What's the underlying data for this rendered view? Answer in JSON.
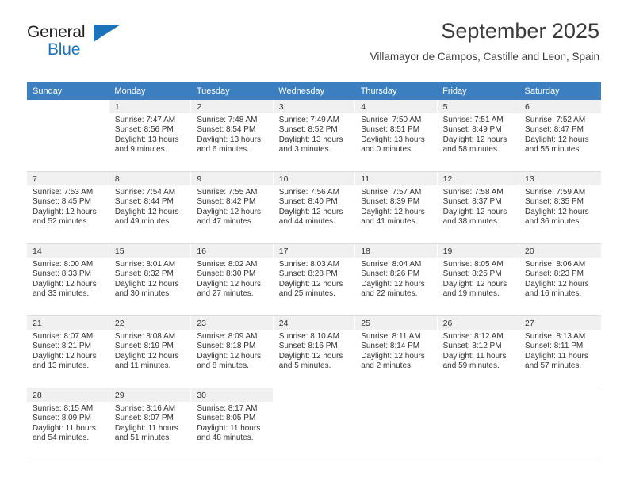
{
  "brand": {
    "name_top": "General",
    "name_bottom": "Blue",
    "accent_color": "#1b74bb"
  },
  "header": {
    "title": "September 2025",
    "subtitle": "Villamayor de Campos, Castille and Leon, Spain"
  },
  "calendar": {
    "header_background": "#3c7fc1",
    "daynum_background": "#f0f0f0",
    "weekday_headers": [
      "Sunday",
      "Monday",
      "Tuesday",
      "Wednesday",
      "Thursday",
      "Friday",
      "Saturday"
    ],
    "weeks": [
      [
        {
          "day": "",
          "lines": []
        },
        {
          "day": "1",
          "lines": [
            "Sunrise: 7:47 AM",
            "Sunset: 8:56 PM",
            "Daylight: 13 hours",
            "and 9 minutes."
          ]
        },
        {
          "day": "2",
          "lines": [
            "Sunrise: 7:48 AM",
            "Sunset: 8:54 PM",
            "Daylight: 13 hours",
            "and 6 minutes."
          ]
        },
        {
          "day": "3",
          "lines": [
            "Sunrise: 7:49 AM",
            "Sunset: 8:52 PM",
            "Daylight: 13 hours",
            "and 3 minutes."
          ]
        },
        {
          "day": "4",
          "lines": [
            "Sunrise: 7:50 AM",
            "Sunset: 8:51 PM",
            "Daylight: 13 hours",
            "and 0 minutes."
          ]
        },
        {
          "day": "5",
          "lines": [
            "Sunrise: 7:51 AM",
            "Sunset: 8:49 PM",
            "Daylight: 12 hours",
            "and 58 minutes."
          ]
        },
        {
          "day": "6",
          "lines": [
            "Sunrise: 7:52 AM",
            "Sunset: 8:47 PM",
            "Daylight: 12 hours",
            "and 55 minutes."
          ]
        }
      ],
      [
        {
          "day": "7",
          "lines": [
            "Sunrise: 7:53 AM",
            "Sunset: 8:45 PM",
            "Daylight: 12 hours",
            "and 52 minutes."
          ]
        },
        {
          "day": "8",
          "lines": [
            "Sunrise: 7:54 AM",
            "Sunset: 8:44 PM",
            "Daylight: 12 hours",
            "and 49 minutes."
          ]
        },
        {
          "day": "9",
          "lines": [
            "Sunrise: 7:55 AM",
            "Sunset: 8:42 PM",
            "Daylight: 12 hours",
            "and 47 minutes."
          ]
        },
        {
          "day": "10",
          "lines": [
            "Sunrise: 7:56 AM",
            "Sunset: 8:40 PM",
            "Daylight: 12 hours",
            "and 44 minutes."
          ]
        },
        {
          "day": "11",
          "lines": [
            "Sunrise: 7:57 AM",
            "Sunset: 8:39 PM",
            "Daylight: 12 hours",
            "and 41 minutes."
          ]
        },
        {
          "day": "12",
          "lines": [
            "Sunrise: 7:58 AM",
            "Sunset: 8:37 PM",
            "Daylight: 12 hours",
            "and 38 minutes."
          ]
        },
        {
          "day": "13",
          "lines": [
            "Sunrise: 7:59 AM",
            "Sunset: 8:35 PM",
            "Daylight: 12 hours",
            "and 36 minutes."
          ]
        }
      ],
      [
        {
          "day": "14",
          "lines": [
            "Sunrise: 8:00 AM",
            "Sunset: 8:33 PM",
            "Daylight: 12 hours",
            "and 33 minutes."
          ]
        },
        {
          "day": "15",
          "lines": [
            "Sunrise: 8:01 AM",
            "Sunset: 8:32 PM",
            "Daylight: 12 hours",
            "and 30 minutes."
          ]
        },
        {
          "day": "16",
          "lines": [
            "Sunrise: 8:02 AM",
            "Sunset: 8:30 PM",
            "Daylight: 12 hours",
            "and 27 minutes."
          ]
        },
        {
          "day": "17",
          "lines": [
            "Sunrise: 8:03 AM",
            "Sunset: 8:28 PM",
            "Daylight: 12 hours",
            "and 25 minutes."
          ]
        },
        {
          "day": "18",
          "lines": [
            "Sunrise: 8:04 AM",
            "Sunset: 8:26 PM",
            "Daylight: 12 hours",
            "and 22 minutes."
          ]
        },
        {
          "day": "19",
          "lines": [
            "Sunrise: 8:05 AM",
            "Sunset: 8:25 PM",
            "Daylight: 12 hours",
            "and 19 minutes."
          ]
        },
        {
          "day": "20",
          "lines": [
            "Sunrise: 8:06 AM",
            "Sunset: 8:23 PM",
            "Daylight: 12 hours",
            "and 16 minutes."
          ]
        }
      ],
      [
        {
          "day": "21",
          "lines": [
            "Sunrise: 8:07 AM",
            "Sunset: 8:21 PM",
            "Daylight: 12 hours",
            "and 13 minutes."
          ]
        },
        {
          "day": "22",
          "lines": [
            "Sunrise: 8:08 AM",
            "Sunset: 8:19 PM",
            "Daylight: 12 hours",
            "and 11 minutes."
          ]
        },
        {
          "day": "23",
          "lines": [
            "Sunrise: 8:09 AM",
            "Sunset: 8:18 PM",
            "Daylight: 12 hours",
            "and 8 minutes."
          ]
        },
        {
          "day": "24",
          "lines": [
            "Sunrise: 8:10 AM",
            "Sunset: 8:16 PM",
            "Daylight: 12 hours",
            "and 5 minutes."
          ]
        },
        {
          "day": "25",
          "lines": [
            "Sunrise: 8:11 AM",
            "Sunset: 8:14 PM",
            "Daylight: 12 hours",
            "and 2 minutes."
          ]
        },
        {
          "day": "26",
          "lines": [
            "Sunrise: 8:12 AM",
            "Sunset: 8:12 PM",
            "Daylight: 11 hours",
            "and 59 minutes."
          ]
        },
        {
          "day": "27",
          "lines": [
            "Sunrise: 8:13 AM",
            "Sunset: 8:11 PM",
            "Daylight: 11 hours",
            "and 57 minutes."
          ]
        }
      ],
      [
        {
          "day": "28",
          "lines": [
            "Sunrise: 8:15 AM",
            "Sunset: 8:09 PM",
            "Daylight: 11 hours",
            "and 54 minutes."
          ]
        },
        {
          "day": "29",
          "lines": [
            "Sunrise: 8:16 AM",
            "Sunset: 8:07 PM",
            "Daylight: 11 hours",
            "and 51 minutes."
          ]
        },
        {
          "day": "30",
          "lines": [
            "Sunrise: 8:17 AM",
            "Sunset: 8:05 PM",
            "Daylight: 11 hours",
            "and 48 minutes."
          ]
        },
        {
          "day": "",
          "lines": []
        },
        {
          "day": "",
          "lines": []
        },
        {
          "day": "",
          "lines": []
        },
        {
          "day": "",
          "lines": []
        }
      ]
    ]
  }
}
